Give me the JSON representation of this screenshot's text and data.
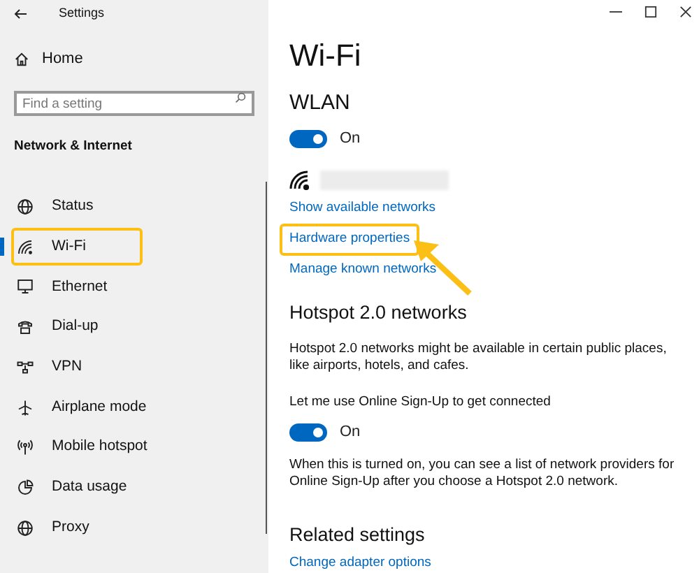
{
  "window": {
    "title": "Settings"
  },
  "sidebar": {
    "home": "Home",
    "search": {
      "placeholder": "Find a setting"
    },
    "section": "Network & Internet",
    "items": [
      {
        "label": "Status",
        "kind": "globe",
        "selected": false,
        "highlighted": false
      },
      {
        "label": "Wi-Fi",
        "kind": "wifi",
        "selected": true,
        "highlighted": true
      },
      {
        "label": "Ethernet",
        "kind": "monitor",
        "selected": false,
        "highlighted": false
      },
      {
        "label": "Dial-up",
        "kind": "phone",
        "selected": false,
        "highlighted": false
      },
      {
        "label": "VPN",
        "kind": "vpn",
        "selected": false,
        "highlighted": false
      },
      {
        "label": "Airplane mode",
        "kind": "plane",
        "selected": false,
        "highlighted": false
      },
      {
        "label": "Mobile hotspot",
        "kind": "hotspot",
        "selected": false,
        "highlighted": false
      },
      {
        "label": "Data usage",
        "kind": "pie",
        "selected": false,
        "highlighted": false
      },
      {
        "label": "Proxy",
        "kind": "globe",
        "selected": false,
        "highlighted": false
      }
    ]
  },
  "page": {
    "title": "Wi-Fi",
    "wlan": {
      "heading": "WLAN",
      "toggle": {
        "on": true,
        "label": "On"
      }
    },
    "links": [
      {
        "label": "Show available networks",
        "highlighted": false
      },
      {
        "label": "Hardware properties",
        "highlighted": true
      },
      {
        "label": "Manage known networks",
        "highlighted": false
      }
    ],
    "hotspot": {
      "heading": "Hotspot 2.0 networks",
      "description": "Hotspot 2.0 networks might be available in certain public places, like airports, hotels, and cafes.",
      "option": "Let me use Online Sign-Up to get connected",
      "toggle": {
        "on": true,
        "label": "On"
      },
      "note": "When this is turned on, you can see a list of network providers for Online Sign-Up after you choose a Hotspot 2.0 network."
    },
    "related": {
      "heading": "Related settings",
      "links": [
        "Change adapter options"
      ]
    }
  }
}
